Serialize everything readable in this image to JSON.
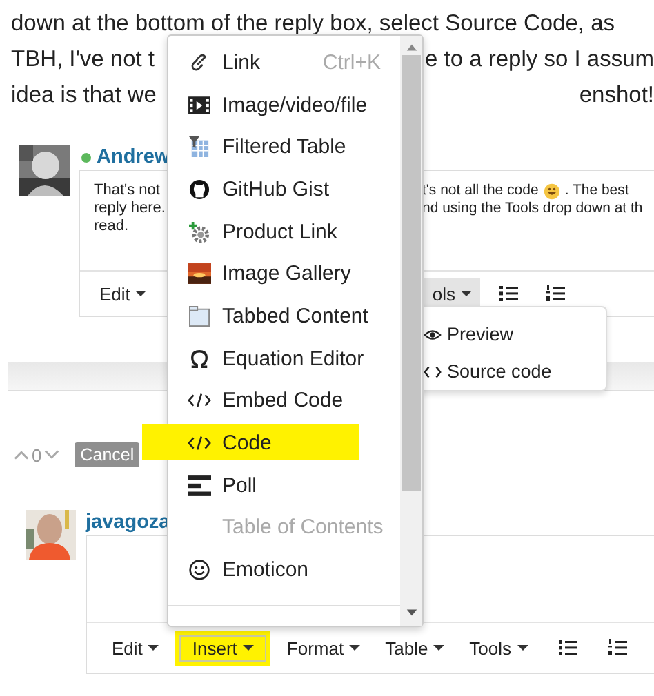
{
  "post_text": {
    "lines": [
      {
        "left": "down at the bottom of the reply box, select Source Code, as"
      },
      {
        "left": "TBH, I've not t",
        "right": "e to a reply so I assum"
      },
      {
        "left": "idea is that we",
        "right": "enshot!"
      }
    ]
  },
  "first_comment": {
    "author": "Andrew",
    "online": true,
    "body": [
      {
        "left": "That's not",
        "right": "t's not all the code",
        "emoji": true,
        "after": ". The best"
      },
      {
        "left": "reply here.",
        "right": "nd using the Tools drop down at th",
        "emoji": false
      },
      {
        "left": "read.",
        "emoji": false
      }
    ],
    "toolbar": [
      {
        "label": "Edit",
        "pressed": false
      },
      {
        "label": "ols",
        "pressed": true
      }
    ],
    "tools_menu": [
      "Preview",
      "Source code"
    ]
  },
  "votes": {
    "count": "0",
    "cancel": "Cancel"
  },
  "reply": {
    "author": "javagoza",
    "toolbar": [
      {
        "label": "Edit",
        "highlighted": false
      },
      {
        "label": "Insert",
        "highlighted": true
      },
      {
        "label": "Format",
        "highlighted": false
      },
      {
        "label": "Table",
        "highlighted": false
      },
      {
        "label": "Tools",
        "highlighted": false
      }
    ]
  },
  "insert_menu": [
    {
      "label": "Link",
      "shortcut": "Ctrl+K",
      "disabled": false,
      "highlighted": false
    },
    {
      "label": "Image/video/file",
      "disabled": false,
      "highlighted": false
    },
    {
      "label": "Filtered Table",
      "disabled": false,
      "highlighted": false
    },
    {
      "label": "GitHub Gist",
      "disabled": false,
      "highlighted": false
    },
    {
      "label": "Product Link",
      "disabled": false,
      "highlighted": false
    },
    {
      "label": "Image Gallery",
      "disabled": false,
      "highlighted": false
    },
    {
      "label": "Tabbed Content",
      "disabled": false,
      "highlighted": false
    },
    {
      "label": "Equation Editor",
      "disabled": false,
      "highlighted": false
    },
    {
      "label": "Embed Code",
      "disabled": false,
      "highlighted": false
    },
    {
      "label": "Code",
      "disabled": false,
      "highlighted": true
    },
    {
      "label": "Poll",
      "disabled": false,
      "highlighted": false
    },
    {
      "label": "Table of Contents",
      "disabled": true,
      "highlighted": false
    },
    {
      "label": "Emoticon",
      "disabled": false,
      "highlighted": false
    }
  ]
}
